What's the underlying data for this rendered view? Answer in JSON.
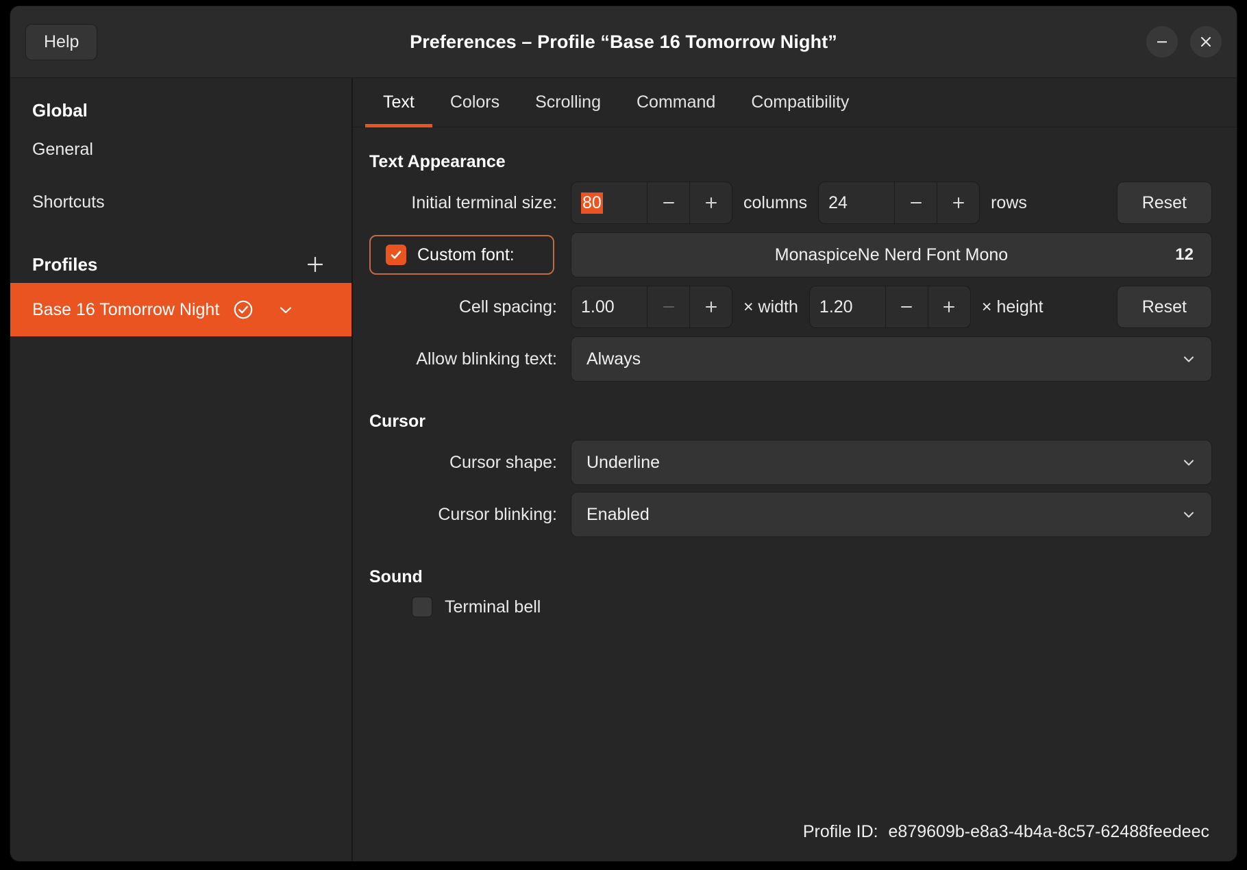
{
  "window": {
    "title": "Preferences – Profile “Base 16 Tomorrow Night”",
    "help_label": "Help",
    "minimize_icon": "minimize-icon",
    "close_icon": "close-icon"
  },
  "sidebar": {
    "global_header": "Global",
    "global_items": [
      {
        "label": "General"
      },
      {
        "label": "Shortcuts"
      }
    ],
    "profiles_header": "Profiles",
    "add_profile_icon": "plus-icon",
    "profiles": [
      {
        "label": "Base 16 Tomorrow Night",
        "selected": true,
        "default_icon": "check-circle-icon",
        "menu_icon": "chevron-down-icon"
      }
    ]
  },
  "tabs": [
    {
      "label": "Text",
      "active": true
    },
    {
      "label": "Colors",
      "active": false
    },
    {
      "label": "Scrolling",
      "active": false
    },
    {
      "label": "Command",
      "active": false
    },
    {
      "label": "Compatibility",
      "active": false
    }
  ],
  "text_appearance": {
    "heading": "Text Appearance",
    "terminal_size": {
      "label": "Initial terminal size:",
      "columns_value": "80",
      "columns_unit": "columns",
      "rows_value": "24",
      "rows_unit": "rows",
      "minus_icon": "minus-icon",
      "plus_icon": "plus-icon",
      "reset_label": "Reset"
    },
    "custom_font": {
      "label": "Custom font:",
      "checked": true,
      "font_name": "MonaspiceNe Nerd Font Mono",
      "font_size": "12"
    },
    "cell_spacing": {
      "label": "Cell spacing:",
      "width_value": "1.00",
      "width_unit": "× width",
      "height_value": "1.20",
      "height_unit": "× height",
      "minus_icon": "minus-icon",
      "plus_icon": "plus-icon",
      "reset_label": "Reset"
    },
    "blinking_text": {
      "label": "Allow blinking text:",
      "value": "Always",
      "chevron_icon": "chevron-down-icon"
    }
  },
  "cursor": {
    "heading": "Cursor",
    "shape": {
      "label": "Cursor shape:",
      "value": "Underline",
      "chevron_icon": "chevron-down-icon"
    },
    "blinking": {
      "label": "Cursor blinking:",
      "value": "Enabled",
      "chevron_icon": "chevron-down-icon"
    }
  },
  "sound": {
    "heading": "Sound",
    "terminal_bell": {
      "label": "Terminal bell",
      "checked": false
    }
  },
  "footer": {
    "profile_id_label": "Profile ID:",
    "profile_id_value": "e879609b-e8a3-4b4a-8c57-62488feedeec"
  },
  "colors": {
    "accent": "#e95420",
    "window_bg": "#262626",
    "headerbar_bg": "#2b2b2b",
    "control_bg": "#343434",
    "text": "#ededed",
    "focus_ring": "#c06a46"
  }
}
